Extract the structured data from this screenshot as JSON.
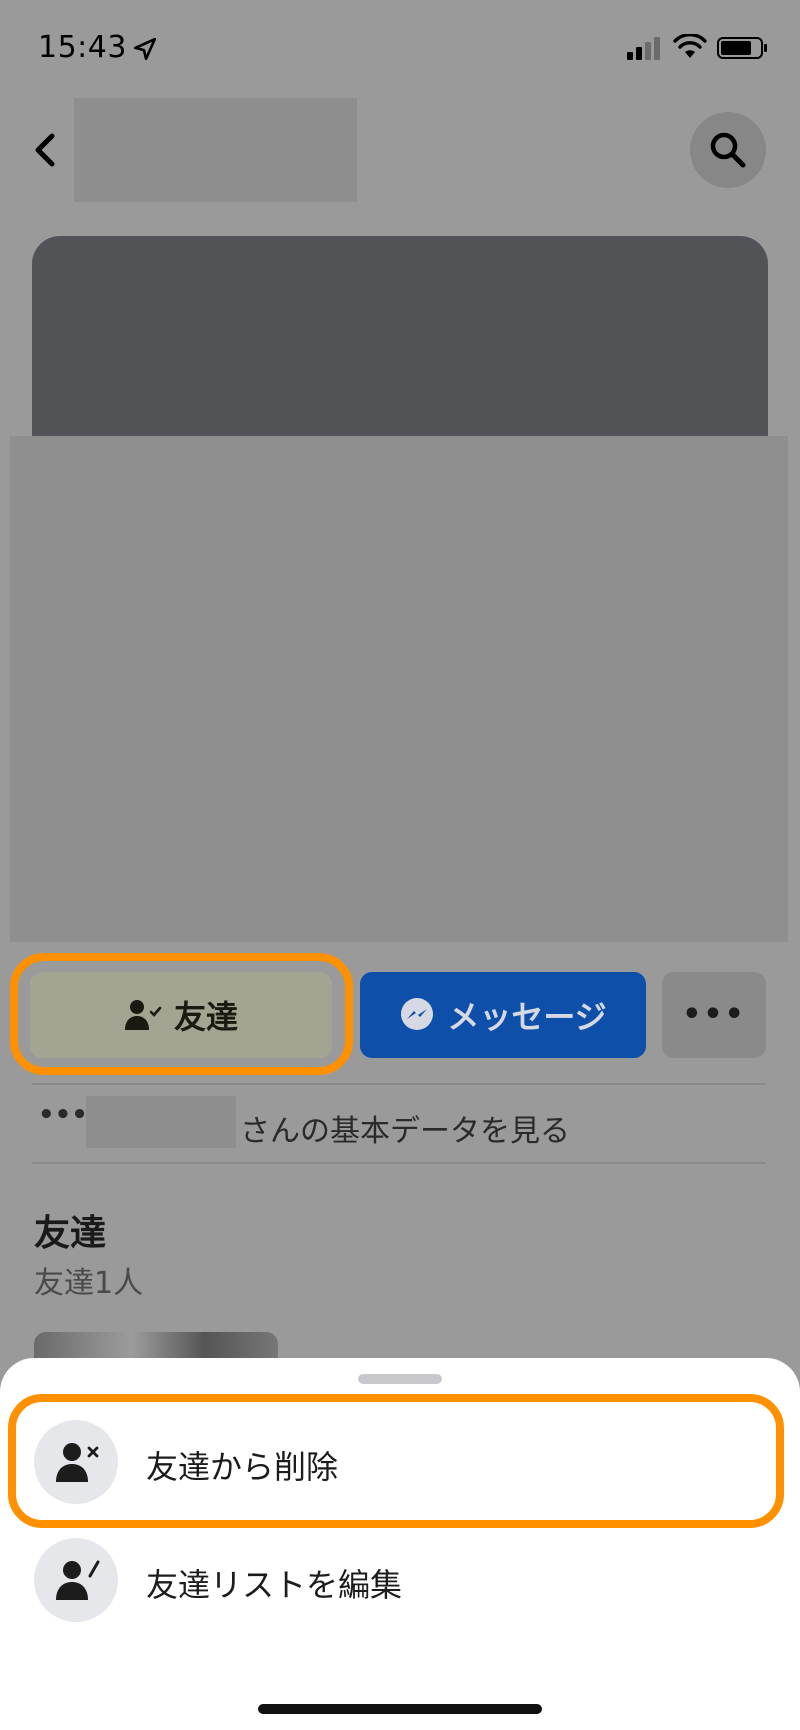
{
  "status_bar": {
    "time": "15:43",
    "icons": [
      "location-arrow-icon",
      "cellular-signal-icon",
      "wifi-icon",
      "battery-icon"
    ]
  },
  "nav": {
    "back_icon": "chevron-left-icon",
    "search_icon": "search-icon"
  },
  "actions": {
    "friends_label": "友達",
    "friends_icon": "person-check-icon",
    "message_label": "メッセージ",
    "message_icon": "messenger-icon",
    "more_label": "•••",
    "accent_blue": "#0d4fa9"
  },
  "about": {
    "dots": "•••",
    "text": "さんの基本データを見る"
  },
  "friends_section": {
    "heading": "友達",
    "count": "友達1人"
  },
  "sheet": {
    "items": [
      {
        "label": "友達から削除",
        "icon": "person-remove-icon"
      },
      {
        "label": "友達リストを編集",
        "icon": "person-edit-icon"
      }
    ]
  },
  "highlight_color": "#ff9000"
}
